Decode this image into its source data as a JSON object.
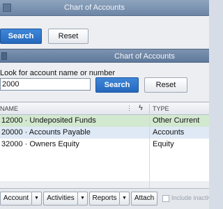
{
  "back_window": {
    "title": "Chart of Accounts",
    "search_label": "Search",
    "reset_label": "Reset"
  },
  "front_window": {
    "title": "Chart of Accounts",
    "look_label": "Look for account name or number",
    "search_value": "2000",
    "search_label": "Search",
    "reset_label": "Reset"
  },
  "grid": {
    "columns": {
      "name": "NAME",
      "type": "TYPE"
    },
    "rows": [
      {
        "name": "12000 · Undeposited Funds",
        "type": "Other Current Asset"
      },
      {
        "name": "20000 · Accounts Payable",
        "type": "Accounts Payable"
      },
      {
        "name": "32000 · Owners Equity",
        "type": "Equity"
      }
    ]
  },
  "toolbar": {
    "account_label": "Account",
    "activities_label": "Activities",
    "reports_label": "Reports",
    "attach_label": "Attach",
    "include_inactive_label": "Include inactive"
  },
  "colors": {
    "primary_button": "#2f77cc",
    "selected_row": "#d2e8cf",
    "alt_row": "#dfe9f6",
    "titlebar": "#6d86a6"
  }
}
